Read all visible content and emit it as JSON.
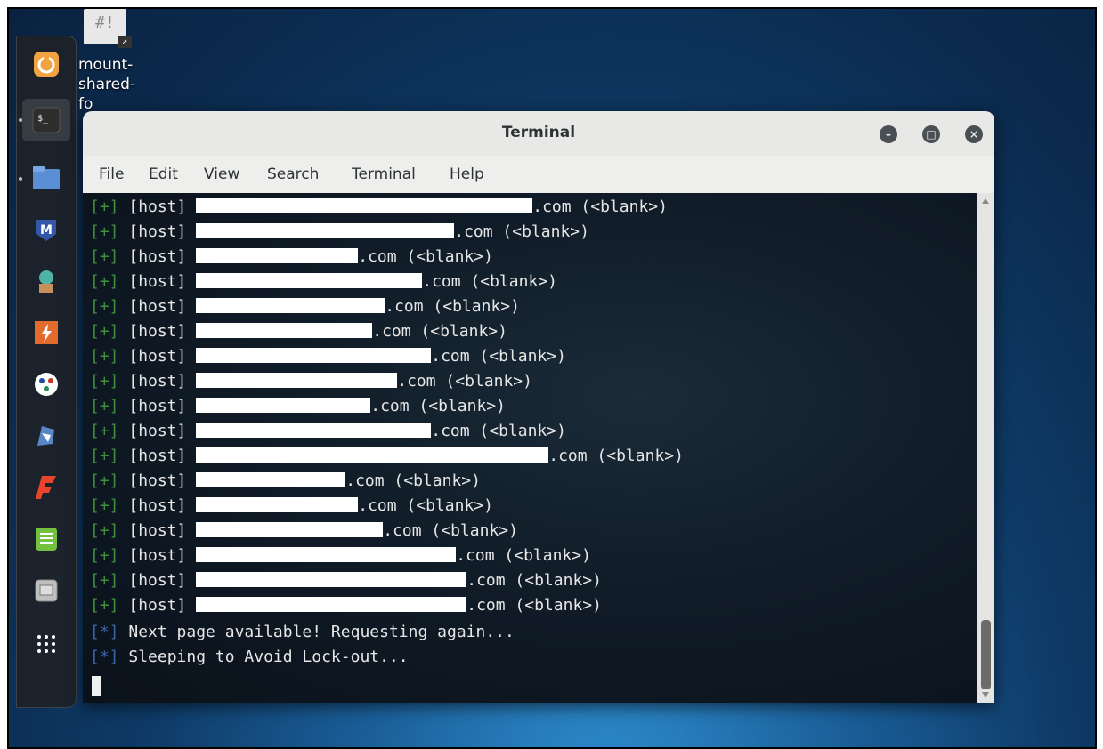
{
  "desktop_shortcut": {
    "icon_text": "#!",
    "label": "mount-\nshared-\nfo"
  },
  "dock": {
    "items": [
      {
        "name": "firefox-icon",
        "color": "#f0a340"
      },
      {
        "name": "terminal-icon",
        "color": "#2d2d2d"
      },
      {
        "name": "files-icon",
        "color": "#5a8fd6"
      },
      {
        "name": "metasploit-icon",
        "color": "#3456a8"
      },
      {
        "name": "armitage-icon",
        "color": "#4fb3a7"
      },
      {
        "name": "burpsuite-icon",
        "color": "#e36c2d"
      },
      {
        "name": "maltego-icon",
        "color": "#ffffff"
      },
      {
        "name": "beef-icon",
        "color": "#5a86c5"
      },
      {
        "name": "faraday-icon",
        "color": "#e8452c"
      },
      {
        "name": "leafpad-icon",
        "color": "#74c03f"
      },
      {
        "name": "screenshot-icon",
        "color": "#bfbfbf"
      },
      {
        "name": "show-apps-icon",
        "color": "#ffffff"
      }
    ]
  },
  "window": {
    "title": "Terminal",
    "controls": {
      "minimize": "–",
      "maximize": "□",
      "close": "×"
    },
    "menu": [
      "File",
      "Edit",
      "View",
      "Search",
      "Terminal",
      "Help"
    ]
  },
  "console": {
    "host_lines": [
      {
        "tag": "[+]",
        "label": "[host]",
        "suffix": ".com (<blank>)"
      },
      {
        "tag": "[+]",
        "label": "[host]",
        "suffix": ".com (<blank>)"
      },
      {
        "tag": "[+]",
        "label": "[host]",
        "suffix": ".com (<blank>)"
      },
      {
        "tag": "[+]",
        "label": "[host]",
        "suffix": ".com (<blank>)"
      },
      {
        "tag": "[+]",
        "label": "[host]",
        "suffix": ".com (<blank>)"
      },
      {
        "tag": "[+]",
        "label": "[host]",
        "suffix": ".com (<blank>)"
      },
      {
        "tag": "[+]",
        "label": "[host]",
        "suffix": ".com (<blank>)"
      },
      {
        "tag": "[+]",
        "label": "[host]",
        "suffix": ".com (<blank>)"
      },
      {
        "tag": "[+]",
        "label": "[host]",
        "suffix": ".com (<blank>)"
      },
      {
        "tag": "[+]",
        "label": "[host]",
        "suffix": ".com (<blank>)"
      },
      {
        "tag": "[+]",
        "label": "[host]",
        "suffix": ".com (<blank>)"
      },
      {
        "tag": "[+]",
        "label": "[host]",
        "suffix": ".com (<blank>)"
      },
      {
        "tag": "[+]",
        "label": "[host]",
        "suffix": ".com (<blank>)"
      },
      {
        "tag": "[+]",
        "label": "[host]",
        "suffix": ".com (<blank>)"
      },
      {
        "tag": "[+]",
        "label": "[host]",
        "suffix": ".com (<blank>)"
      },
      {
        "tag": "[+]",
        "label": "[host]",
        "suffix": ".com (<blank>)"
      },
      {
        "tag": "[+]",
        "label": "[host]",
        "suffix": ".com (<blank>)"
      }
    ],
    "status_lines": [
      {
        "tag": "[*]",
        "text": "Next page available! Requesting again..."
      },
      {
        "tag": "[*]",
        "text": "Sleeping to Avoid Lock-out..."
      }
    ]
  }
}
